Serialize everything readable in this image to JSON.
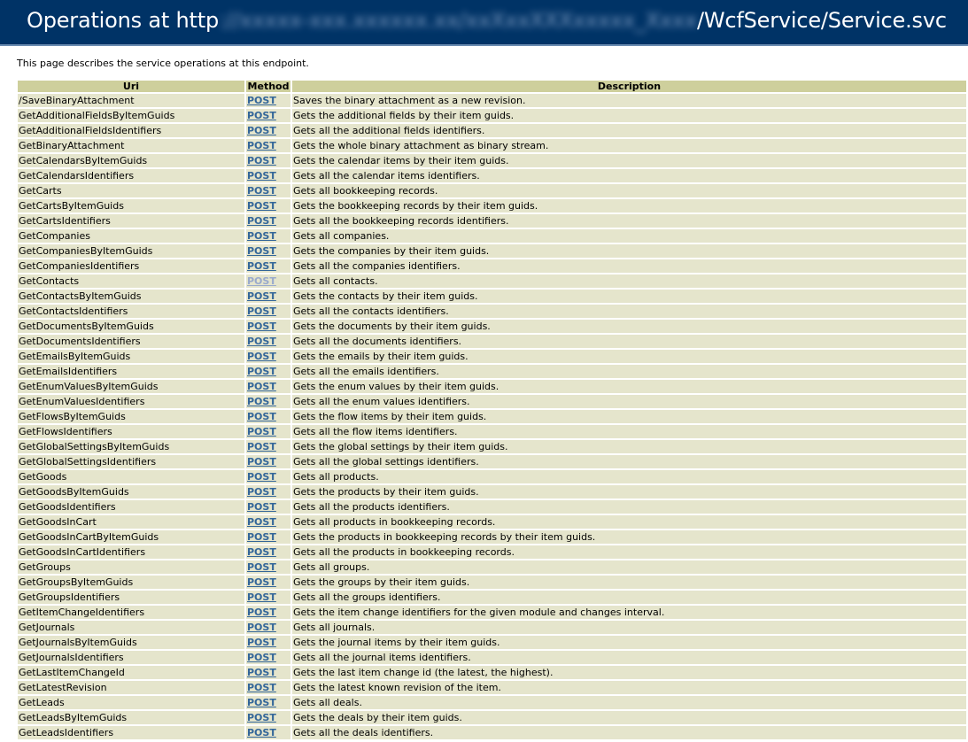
{
  "header": {
    "title_prefix": "Operations at http",
    "title_blurred": "://xxxxx-xxx.xxxxxx.xx/xxXxxXXXxxxxx_Xxxx",
    "title_suffix": "/WcfService/Service.svc"
  },
  "intro": "This page describes the service operations at this endpoint.",
  "table": {
    "headers": {
      "uri": "Uri",
      "method": "Method",
      "description": "Description"
    },
    "rows": [
      {
        "uri": "/SaveBinaryAttachment",
        "method": "POST",
        "description": "Saves the binary attachment as a new revision."
      },
      {
        "uri": "GetAdditionalFieldsByItemGuids",
        "method": "POST",
        "description": "Gets the additional fields by their item guids."
      },
      {
        "uri": "GetAdditionalFieldsIdentifiers",
        "method": "POST",
        "description": "Gets all the additional fields identifiers."
      },
      {
        "uri": "GetBinaryAttachment",
        "method": "POST",
        "description": "Gets the whole binary attachment as binary stream."
      },
      {
        "uri": "GetCalendarsByItemGuids",
        "method": "POST",
        "description": "Gets the calendar items by their item guids."
      },
      {
        "uri": "GetCalendarsIdentifiers",
        "method": "POST",
        "description": "Gets all the calendar items identifiers."
      },
      {
        "uri": "GetCarts",
        "method": "POST",
        "description": "Gets all bookkeeping records."
      },
      {
        "uri": "GetCartsByItemGuids",
        "method": "POST",
        "description": "Gets the bookkeeping records by their item guids."
      },
      {
        "uri": "GetCartsIdentifiers",
        "method": "POST",
        "description": "Gets all the bookkeeping records identifiers."
      },
      {
        "uri": "GetCompanies",
        "method": "POST",
        "description": "Gets all companies."
      },
      {
        "uri": "GetCompaniesByItemGuids",
        "method": "POST",
        "description": "Gets the companies by their item guids."
      },
      {
        "uri": "GetCompaniesIdentifiers",
        "method": "POST",
        "description": "Gets all the companies identifiers."
      },
      {
        "uri": "GetContacts",
        "method": "POST",
        "description": "Gets all contacts.",
        "visited": true
      },
      {
        "uri": "GetContactsByItemGuids",
        "method": "POST",
        "description": "Gets the contacts by their item guids."
      },
      {
        "uri": "GetContactsIdentifiers",
        "method": "POST",
        "description": "Gets all the contacts identifiers."
      },
      {
        "uri": "GetDocumentsByItemGuids",
        "method": "POST",
        "description": "Gets the documents by their item guids."
      },
      {
        "uri": "GetDocumentsIdentifiers",
        "method": "POST",
        "description": "Gets all the documents identifiers."
      },
      {
        "uri": "GetEmailsByItemGuids",
        "method": "POST",
        "description": "Gets the emails by their item guids."
      },
      {
        "uri": "GetEmailsIdentifiers",
        "method": "POST",
        "description": "Gets all the emails identifiers."
      },
      {
        "uri": "GetEnumValuesByItemGuids",
        "method": "POST",
        "description": "Gets the enum values by their item guids."
      },
      {
        "uri": "GetEnumValuesIdentifiers",
        "method": "POST",
        "description": "Gets all the enum values identifiers."
      },
      {
        "uri": "GetFlowsByItemGuids",
        "method": "POST",
        "description": "Gets the flow items by their item guids."
      },
      {
        "uri": "GetFlowsIdentifiers",
        "method": "POST",
        "description": "Gets all the flow items identifiers."
      },
      {
        "uri": "GetGlobalSettingsByItemGuids",
        "method": "POST",
        "description": "Gets the global settings by their item guids."
      },
      {
        "uri": "GetGlobalSettingsIdentifiers",
        "method": "POST",
        "description": "Gets all the global settings identifiers."
      },
      {
        "uri": "GetGoods",
        "method": "POST",
        "description": "Gets all products."
      },
      {
        "uri": "GetGoodsByItemGuids",
        "method": "POST",
        "description": "Gets the products by their item guids."
      },
      {
        "uri": "GetGoodsIdentifiers",
        "method": "POST",
        "description": "Gets all the products identifiers."
      },
      {
        "uri": "GetGoodsInCart",
        "method": "POST",
        "description": "Gets all products in bookkeeping records."
      },
      {
        "uri": "GetGoodsInCartByItemGuids",
        "method": "POST",
        "description": "Gets the products in bookkeeping records by their item guids."
      },
      {
        "uri": "GetGoodsInCartIdentifiers",
        "method": "POST",
        "description": "Gets all the products in bookkeeping records."
      },
      {
        "uri": "GetGroups",
        "method": "POST",
        "description": "Gets all groups."
      },
      {
        "uri": "GetGroupsByItemGuids",
        "method": "POST",
        "description": "Gets the groups by their item guids."
      },
      {
        "uri": "GetGroupsIdentifiers",
        "method": "POST",
        "description": "Gets all the groups identifiers."
      },
      {
        "uri": "GetItemChangeIdentifiers",
        "method": "POST",
        "description": "Gets the item change identifiers for the given module and changes interval."
      },
      {
        "uri": "GetJournals",
        "method": "POST",
        "description": "Gets all journals."
      },
      {
        "uri": "GetJournalsByItemGuids",
        "method": "POST",
        "description": "Gets the journal items by their item guids."
      },
      {
        "uri": "GetJournalsIdentifiers",
        "method": "POST",
        "description": "Gets all the journal items identifiers."
      },
      {
        "uri": "GetLastItemChangeId",
        "method": "POST",
        "description": "Gets the last item change id (the latest, the highest)."
      },
      {
        "uri": "GetLatestRevision",
        "method": "POST",
        "description": "Gets the latest known revision of the item."
      },
      {
        "uri": "GetLeads",
        "method": "POST",
        "description": "Gets all deals."
      },
      {
        "uri": "GetLeadsByItemGuids",
        "method": "POST",
        "description": "Gets the deals by their item guids."
      },
      {
        "uri": "GetLeadsIdentifiers",
        "method": "POST",
        "description": "Gets all the deals identifiers."
      }
    ]
  },
  "colors": {
    "header_bg": "#003366",
    "table_header_bg": "#cecf9c",
    "row_bg": "#e5e5cc",
    "link": "#336699",
    "link_visited": "#99aacc"
  }
}
